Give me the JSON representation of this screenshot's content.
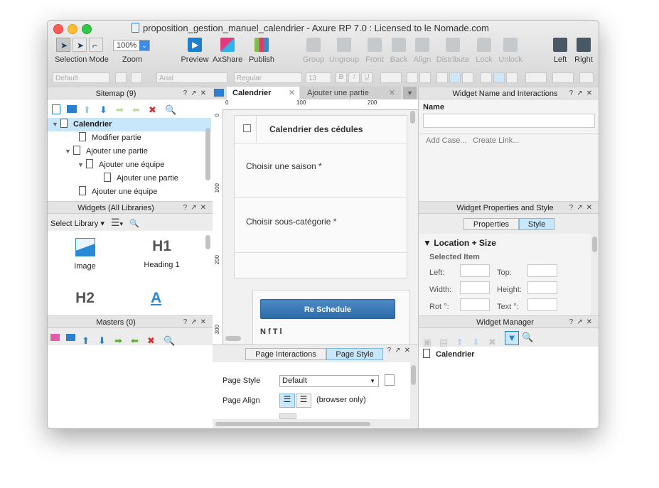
{
  "window": {
    "title": "proposition_gestion_manuel_calendrier - Axure RP 7.0 : Licensed to le Nomade.com"
  },
  "toolbar": {
    "selection_mode": "Selection Mode",
    "zoom_value": "100%",
    "zoom_label": "Zoom",
    "preview": "Preview",
    "axshare": "AxShare",
    "publish": "Publish",
    "group": "Group",
    "ungroup": "Ungroup",
    "front": "Front",
    "back": "Back",
    "align": "Align",
    "distribute": "Distribute",
    "lock": "Lock",
    "unlock": "Unlock",
    "left": "Left",
    "right": "Right"
  },
  "format": {
    "style": "Default",
    "font": "Arial",
    "weight": "Regular",
    "size": "13",
    "bold": "B",
    "italic": "I",
    "underline": "U"
  },
  "sitemap": {
    "title": "Sitemap (9)",
    "items": [
      {
        "label": "Calendrier"
      },
      {
        "label": "Modifier partie"
      },
      {
        "label": "Ajouter une partie"
      },
      {
        "label": "Ajouter une équipe"
      },
      {
        "label": "Ajouter une partie"
      },
      {
        "label": "Ajouter une équipe"
      }
    ]
  },
  "widgets": {
    "title": "Widgets (All Libraries)",
    "select_library": "Select Library",
    "items": [
      {
        "label": "Image"
      },
      {
        "label": "Heading 1",
        "glyph": "H1"
      },
      {
        "label": "",
        "glyph": "H2"
      },
      {
        "label": "",
        "glyph": "A"
      }
    ]
  },
  "masters": {
    "title": "Masters (0)"
  },
  "tabs": {
    "active": "Calendrier",
    "inactive": "Ajouter une partie"
  },
  "ruler": {
    "marks_h": [
      "0",
      "100",
      "200"
    ],
    "marks_v": [
      "0",
      "100",
      "200",
      "300"
    ]
  },
  "canvas": {
    "header_title": "Calendrier des cédules",
    "field1": "Choisir une saison *",
    "field2": "Choisir sous-catégorie *",
    "button": "Re Schedule",
    "cut_text": "N               f            T               l"
  },
  "page_panel": {
    "tab_interactions": "Page Interactions",
    "tab_style": "Page Style",
    "page_style_label": "Page Style",
    "page_style_value": "Default",
    "page_align_label": "Page Align",
    "browser_only": "(browser only)"
  },
  "interactions": {
    "title": "Widget Name and Interactions",
    "name_label": "Name",
    "add_case": "Add Case...",
    "create_link": "Create Link..."
  },
  "properties": {
    "title": "Widget Properties and Style",
    "tab_properties": "Properties",
    "tab_style": "Style",
    "section": "Location + Size",
    "selected_item": "Selected Item",
    "left": "Left:",
    "top": "Top:",
    "width": "Width:",
    "height": "Height:",
    "rot": "Rot °:",
    "text": "Text °:"
  },
  "manager": {
    "title": "Widget Manager",
    "item": "Calendrier"
  },
  "colors": {
    "accent": "#2b7fd0",
    "selection": "#c8e7fb",
    "button": "#3476b4"
  }
}
